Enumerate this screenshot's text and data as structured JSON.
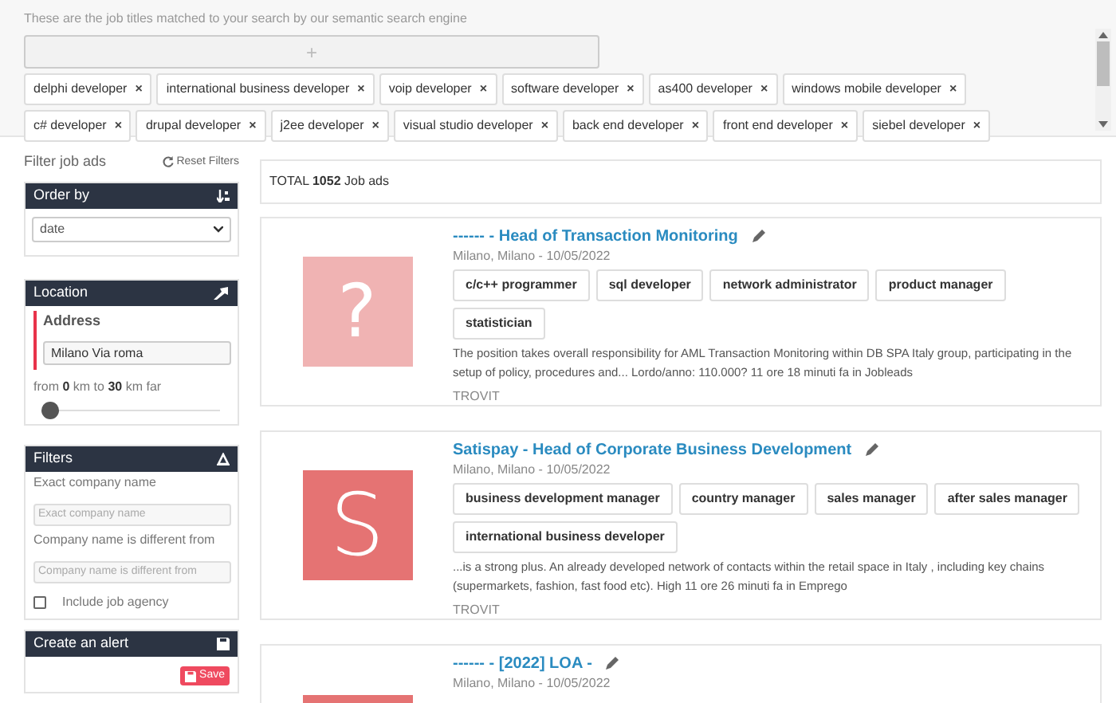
{
  "search_tags": {
    "caption": "These are the job titles matched to your search by our semantic search engine",
    "add_button": "+",
    "tags": [
      {
        "label": "delphi developer",
        "remove": "×"
      },
      {
        "label": "international business developer",
        "remove": "×"
      },
      {
        "label": "voip developer",
        "remove": "×"
      },
      {
        "label": "software developer",
        "remove": "×"
      },
      {
        "label": "as400 developer",
        "remove": "×"
      },
      {
        "label": "windows mobile developer",
        "remove": "×"
      },
      {
        "label": "c# developer",
        "remove": "×"
      },
      {
        "label": "drupal developer",
        "remove": "×"
      },
      {
        "label": "j2ee developer",
        "remove": "×"
      },
      {
        "label": "visual studio developer",
        "remove": "×"
      },
      {
        "label": "back end developer",
        "remove": "×"
      },
      {
        "label": "front end developer",
        "remove": "×"
      },
      {
        "label": "siebel developer",
        "remove": "×"
      }
    ]
  },
  "sidebar": {
    "title": "Filter job ads",
    "reset": "Reset Filters",
    "order_by": {
      "header": "Order by",
      "value": "date"
    },
    "location": {
      "header": "Location",
      "address_label": "Address",
      "address_value": "Milano Via roma",
      "range": [
        "from ",
        "0",
        " km to ",
        "30",
        " km far"
      ],
      "slider": {
        "level": 0
      }
    },
    "filters": {
      "header": "Filters",
      "exact_label": "Exact company name",
      "exact_placeholder": "Exact company name",
      "different_label": "Company name is different from",
      "different_placeholder": "Company name is different from",
      "agency": {
        "label": "Include job agency",
        "checked": false
      }
    },
    "alert": {
      "header": "Create an alert",
      "save": "Save"
    }
  },
  "results": {
    "total_prefix": "TOTAL",
    "total_count": "1052",
    "total_suffix": "Job ads",
    "jobs": [
      {
        "title": "------ - Head of Transaction Monitoring",
        "location": "Milano, Milano - 10/05/2022",
        "logo": {
          "kind": "question",
          "text": "?",
          "color": "#f0b3b3"
        },
        "tags": [
          "c/c++ programmer",
          "sql developer",
          "network administrator",
          "product manager",
          "statistician"
        ],
        "description": "The position takes overall responsibility for AML Transaction Monitoring within DB SPA Italy group, participating in the setup of policy, procedures and... Lordo/anno: 110.000? 11 ore 18 minuti fa in Jobleads",
        "source": "TROVIT"
      },
      {
        "title": "Satispay - Head of Corporate Business Development",
        "location": "Milano, Milano - 10/05/2022",
        "logo": {
          "kind": "letter",
          "text": "S",
          "color": "#e57373"
        },
        "tags": [
          "business development manager",
          "country manager",
          "sales manager",
          "after sales manager",
          "international business developer"
        ],
        "description": "...is a strong plus. An already developed network of contacts within the retail space in Italy , including key chains (supermarkets, fashion, fast food etc). High 11 ore 26 minuti fa in Emprego",
        "source": "TROVIT"
      },
      {
        "title": "------ - [2022] LOA -",
        "location": "Milano, Milano - 10/05/2022",
        "logo": {
          "kind": "blank",
          "color": "#e57373"
        }
      }
    ]
  }
}
